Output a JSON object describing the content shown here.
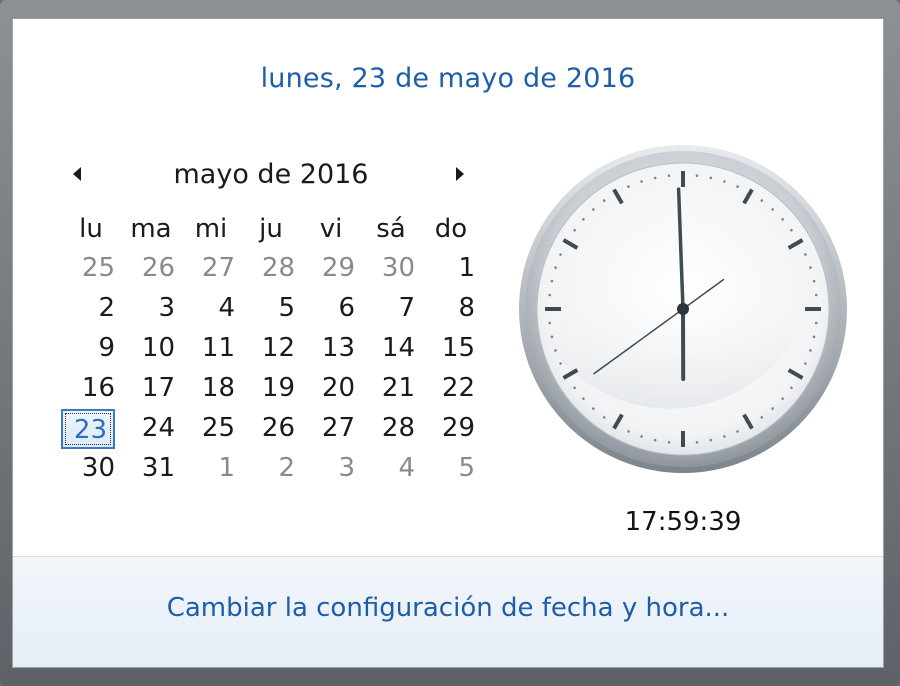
{
  "header": {
    "long_date": "lunes, 23 de mayo de 2016"
  },
  "calendar": {
    "month_title": "mayo de 2016",
    "days_of_week": [
      "lu",
      "ma",
      "mi",
      "ju",
      "vi",
      "sá",
      "do"
    ],
    "weeks": [
      [
        {
          "d": "25",
          "other": true
        },
        {
          "d": "26",
          "other": true
        },
        {
          "d": "27",
          "other": true
        },
        {
          "d": "28",
          "other": true
        },
        {
          "d": "29",
          "other": true
        },
        {
          "d": "30",
          "other": true
        },
        {
          "d": "1"
        }
      ],
      [
        {
          "d": "2"
        },
        {
          "d": "3"
        },
        {
          "d": "4"
        },
        {
          "d": "5"
        },
        {
          "d": "6"
        },
        {
          "d": "7"
        },
        {
          "d": "8"
        }
      ],
      [
        {
          "d": "9"
        },
        {
          "d": "10"
        },
        {
          "d": "11"
        },
        {
          "d": "12"
        },
        {
          "d": "13"
        },
        {
          "d": "14"
        },
        {
          "d": "15"
        }
      ],
      [
        {
          "d": "16"
        },
        {
          "d": "17"
        },
        {
          "d": "18"
        },
        {
          "d": "19"
        },
        {
          "d": "20"
        },
        {
          "d": "21"
        },
        {
          "d": "22"
        }
      ],
      [
        {
          "d": "23",
          "today": true
        },
        {
          "d": "24"
        },
        {
          "d": "25"
        },
        {
          "d": "26"
        },
        {
          "d": "27"
        },
        {
          "d": "28"
        },
        {
          "d": "29"
        }
      ],
      [
        {
          "d": "30"
        },
        {
          "d": "31"
        },
        {
          "d": "1",
          "other": true
        },
        {
          "d": "2",
          "other": true
        },
        {
          "d": "3",
          "other": true
        },
        {
          "d": "4",
          "other": true
        },
        {
          "d": "5",
          "other": true
        }
      ]
    ],
    "prev_icon": "chevron-left-icon",
    "next_icon": "chevron-right-icon"
  },
  "clock": {
    "time": "17:59:39",
    "hours": 17,
    "minutes": 59,
    "seconds": 39
  },
  "footer": {
    "link_label": "Cambiar la configuración de fecha y hora..."
  },
  "colors": {
    "accent": "#1e5ea8",
    "today_border": "#3a7bc8",
    "other_month": "#8a8a8a"
  }
}
